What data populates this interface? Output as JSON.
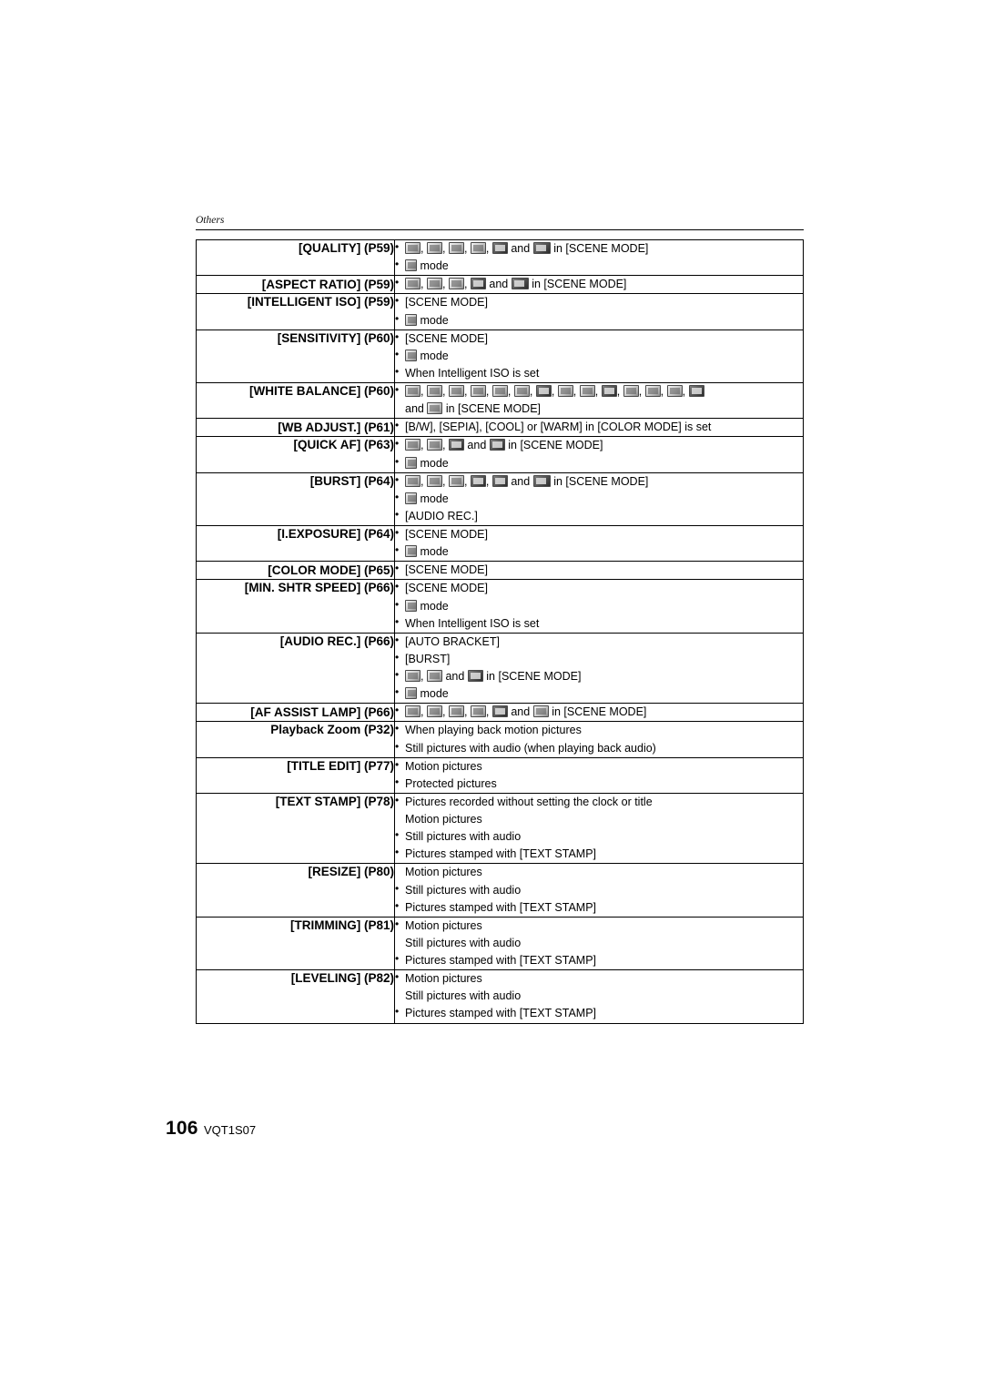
{
  "header": {
    "section": "Others"
  },
  "footer": {
    "page_number": "106",
    "doc_code": "VQT1S07"
  },
  "table": {
    "rows": [
      {
        "label": "[QUALITY] (P59)",
        "lines": [
          {
            "bullet": true,
            "icons": 6,
            "text_before": "",
            "text_after": " and ",
            "text_end": " in [SCENE MODE]"
          },
          {
            "bullet": true,
            "text": " mode"
          }
        ]
      },
      {
        "label": "[ASPECT RATIO] (P59)",
        "lines": [
          {
            "bullet": true,
            "text": " and  in [SCENE MODE]"
          }
        ]
      },
      {
        "label": "[INTELLIGENT ISO] (P59)",
        "lines": [
          {
            "bullet": true,
            "text": "[SCENE MODE]"
          },
          {
            "bullet": true,
            "text": " mode"
          }
        ]
      },
      {
        "label": "[SENSITIVITY] (P60)",
        "lines": [
          {
            "bullet": true,
            "text": "[SCENE MODE]"
          },
          {
            "bullet": true,
            "text": " mode"
          },
          {
            "bullet": true,
            "text": "When Intelligent ISO is set"
          }
        ]
      },
      {
        "label": "[WHITE BALANCE] (P60)",
        "lines": [
          {
            "bullet": true,
            "text": ""
          },
          {
            "bullet": false,
            "text": "and  in [SCENE MODE]"
          }
        ]
      },
      {
        "label": "[WB ADJUST.] (P61)",
        "lines": [
          {
            "bullet": true,
            "text": "[B/W], [SEPIA], [COOL] or [WARM] in [COLOR MODE] is set"
          }
        ]
      },
      {
        "label": "[QUICK AF] (P63)",
        "lines": [
          {
            "bullet": true,
            "text": " and  in [SCENE MODE]"
          },
          {
            "bullet": true,
            "text": " mode"
          }
        ]
      },
      {
        "label": "[BURST] (P64)",
        "lines": [
          {
            "bullet": true,
            "text": " and  in [SCENE MODE]"
          },
          {
            "bullet": true,
            "text": " mode"
          },
          {
            "bullet": true,
            "text": "[AUDIO REC.]"
          }
        ]
      },
      {
        "label": "[I.EXPOSURE] (P64)",
        "lines": [
          {
            "bullet": true,
            "text": "[SCENE MODE]"
          },
          {
            "bullet": true,
            "text": " mode"
          }
        ]
      },
      {
        "label": "[COLOR MODE] (P65)",
        "lines": [
          {
            "bullet": true,
            "text": "[SCENE MODE]"
          }
        ]
      },
      {
        "label": "[MIN. SHTR SPEED] (P66)",
        "lines": [
          {
            "bullet": true,
            "text": "[SCENE MODE]"
          },
          {
            "bullet": true,
            "text": " mode"
          },
          {
            "bullet": true,
            "text": "When Intelligent ISO is set"
          }
        ]
      },
      {
        "label": "[AUDIO REC.] (P66)",
        "lines": [
          {
            "bullet": true,
            "text": "[AUTO BRACKET]"
          },
          {
            "bullet": true,
            "text": "[BURST]"
          },
          {
            "bullet": true,
            "text": " and  in [SCENE MODE]"
          },
          {
            "bullet": true,
            "text": " mode"
          }
        ]
      },
      {
        "label": "[AF ASSIST LAMP] (P66)",
        "lines": [
          {
            "bullet": true,
            "text": " and  in [SCENE MODE]"
          }
        ]
      },
      {
        "label": "Playback Zoom (P32)",
        "lines": [
          {
            "bullet": true,
            "text": "When playing back motion pictures"
          },
          {
            "bullet": true,
            "text": "Still pictures with audio (when playing back audio)"
          }
        ]
      },
      {
        "label": "[TITLE EDIT] (P77)",
        "lines": [
          {
            "bullet": true,
            "text": "Motion pictures"
          },
          {
            "bullet": true,
            "text": "Protected pictures"
          }
        ]
      },
      {
        "label": "[TEXT STAMP] (P78)",
        "lines": [
          {
            "bullet": true,
            "text": "Pictures recorded without setting the clock or title"
          },
          {
            "bullet": true,
            "text": "Motion pictures"
          },
          {
            "bullet": true,
            "text": "Still pictures with audio"
          },
          {
            "bullet": true,
            "text": "Pictures stamped with [TEXT STAMP]"
          }
        ]
      },
      {
        "label": "[RESIZE] (P80)",
        "lines": [
          {
            "bullet": true,
            "text": "Motion pictures"
          },
          {
            "bullet": true,
            "text": "Still pictures with audio"
          },
          {
            "bullet": true,
            "text": "Pictures stamped with [TEXT STAMP]"
          }
        ]
      },
      {
        "label": "[TRIMMING] (P81)",
        "lines": [
          {
            "bullet": true,
            "text": "Motion pictures"
          },
          {
            "bullet": true,
            "text": "Still pictures with audio"
          },
          {
            "bullet": true,
            "text": "Pictures stamped with [TEXT STAMP]"
          }
        ]
      },
      {
        "label": "[LEVELING] (P82)",
        "lines": [
          {
            "bullet": true,
            "text": "Motion pictures"
          },
          {
            "bullet": true,
            "text": "Still pictures with audio"
          },
          {
            "bullet": true,
            "text": "Pictures stamped with [TEXT STAMP]"
          }
        ]
      }
    ]
  },
  "text": {
    "and": "and",
    "in_scene_mode": "in [SCENE MODE]",
    "mode": "mode",
    "scene_mode": "[SCENE MODE]",
    "when_iso": "When Intelligent ISO is set",
    "audio_rec": "[AUDIO REC.]",
    "auto_bracket": "[AUTO BRACKET]",
    "burst": "[BURST]",
    "wb_adjust_detail": "[B/W], [SEPIA], [COOL] or [WARM] in [COLOR MODE] is set",
    "motion_pictures": "Motion pictures",
    "protected_pictures": "Protected pictures",
    "still_with_audio": "Still pictures with audio",
    "still_with_audio_play": "Still pictures with audio (when playing back audio)",
    "stamped": "Pictures stamped with [TEXT STAMP]",
    "playing_motion": "When playing back motion pictures",
    "no_clock_title": "Pictures recorded without setting the clock or title",
    "comma": ",",
    "labels": {
      "quality": "[QUALITY] (P59)",
      "aspect_ratio": "[ASPECT RATIO] (P59)",
      "intelligent_iso": "[INTELLIGENT ISO] (P59)",
      "sensitivity": "[SENSITIVITY] (P60)",
      "white_balance": "[WHITE BALANCE] (P60)",
      "wb_adjust": "[WB ADJUST.] (P61)",
      "quick_af": "[QUICK AF] (P63)",
      "burst": "[BURST] (P64)",
      "i_exposure": "[I.EXPOSURE] (P64)",
      "color_mode": "[COLOR MODE] (P65)",
      "min_shtr_speed": "[MIN. SHTR SPEED] (P66)",
      "audio_rec": "[AUDIO REC.] (P66)",
      "af_assist_lamp": "[AF ASSIST LAMP] (P66)",
      "playback_zoom": "Playback Zoom (P32)",
      "title_edit": "[TITLE EDIT] (P77)",
      "text_stamp": "[TEXT STAMP] (P78)",
      "resize": "[RESIZE] (P80)",
      "trimming": "[TRIMMING] (P81)",
      "leveling": "[LEVELING] (P82)"
    }
  }
}
